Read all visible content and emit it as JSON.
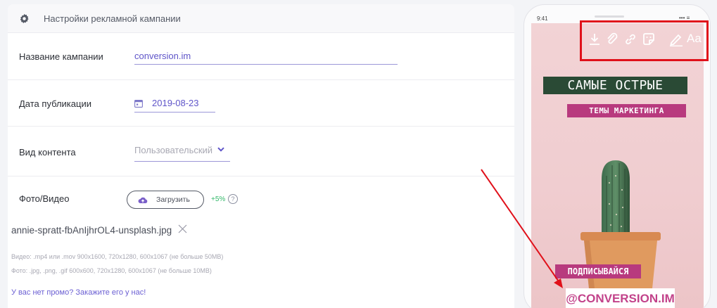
{
  "settings": {
    "title": "Настройки рекламной кампании",
    "campaign_name": {
      "label": "Название кампании",
      "value": "conversion.im"
    },
    "publish_date": {
      "label": "Дата публикации",
      "value": "2019-08-23"
    },
    "content_type": {
      "label": "Вид контента",
      "value": "Пользовательский"
    },
    "media": {
      "label": "Фото/Видео",
      "upload_label": "Загрузить",
      "bonus": "+5%",
      "help": "?",
      "filename": "annie-spratt-fbAnIjhrOL4-unsplash.jpg",
      "video_hint": "Видео: .mp4 или .mov 900x1600, 720x1280, 600x1067 (не больше 50MB)",
      "photo_hint": "Фото: .jpg, .png, .gif 600x600, 720x1280, 600x1067 (не больше 10MB)"
    },
    "promo_link": "У вас нет промо? Закажите его у нас!"
  },
  "preview": {
    "time": "9:41",
    "status_icons": "••• ≡",
    "toolbar": {
      "icons": [
        "download-icon",
        "paperclip-icon",
        "link-icon",
        "sticker-icon",
        "draw-icon",
        "text-icon"
      ],
      "text_tool": "Aa"
    },
    "headline_1": "САМЫЕ ОСТРЫЕ",
    "headline_2": "ТЕМЫ МАРКЕТИНГА",
    "subscribe": "ПОДПИСЫВАЙСЯ",
    "handle": "@CONVERSION.IM"
  },
  "colors": {
    "accent": "#5f55c9",
    "highlight_frame": "#e0101a",
    "annotation_arrow": "#e0101a",
    "headline_green": "#2a4a35",
    "headline_pink": "#b83a7e"
  }
}
